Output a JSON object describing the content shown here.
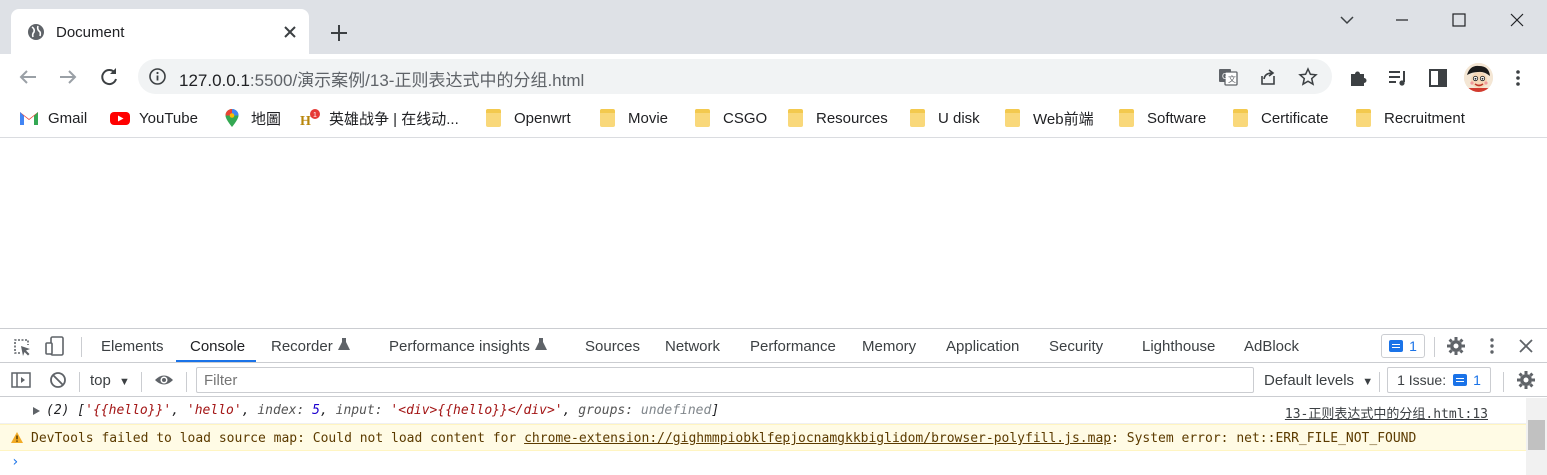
{
  "tab": {
    "title": "Document"
  },
  "window": {
    "controls": [
      "chevron-down",
      "minimize",
      "maximize",
      "close"
    ]
  },
  "omnibox": {
    "host": "127.0.0.1",
    "path": ":5500/演示案例/13-正则表达式中的分组.html"
  },
  "bookmarks": [
    {
      "label": "Gmail",
      "icon": "gmail-icon"
    },
    {
      "label": "YouTube",
      "icon": "youtube-icon"
    },
    {
      "label": "地圖",
      "icon": "maps-icon"
    },
    {
      "label": "英雄战争 | 在线动...",
      "icon": "game-icon"
    },
    {
      "label": "Openwrt",
      "icon": "folder-icon"
    },
    {
      "label": "Movie",
      "icon": "folder-icon"
    },
    {
      "label": "CSGO",
      "icon": "folder-icon"
    },
    {
      "label": "Resources",
      "icon": "folder-icon"
    },
    {
      "label": "U disk",
      "icon": "folder-icon"
    },
    {
      "label": "Web前端",
      "icon": "folder-icon"
    },
    {
      "label": "Software",
      "icon": "folder-icon"
    },
    {
      "label": "Certificate",
      "icon": "folder-icon"
    },
    {
      "label": "Recruitment",
      "icon": "folder-icon"
    }
  ],
  "devtools": {
    "tabs": [
      "Elements",
      "Console",
      "Recorder",
      "Performance insights",
      "Sources",
      "Network",
      "Performance",
      "Memory",
      "Application",
      "Security",
      "Lighthouse",
      "AdBlock"
    ],
    "active_tab": "Console",
    "issue_badge_count": "1",
    "filterbar": {
      "context": "top",
      "filter_placeholder": "Filter",
      "levels": "Default levels",
      "issues_label": "1 Issue:",
      "issues_count": "1"
    },
    "console": {
      "log": {
        "count": "(2)",
        "item1": "'{{hello}}'",
        "item2": "'hello'",
        "index_key": "index:",
        "index_val": "5",
        "input_key": "input:",
        "input_val": "'<div>{{hello}}</div>'",
        "groups_key": "groups:",
        "groups_val": "undefined",
        "source": "13-正则表达式中的分组.html:13"
      },
      "warning": {
        "prefix": "DevTools failed to load source map: Could not load content for ",
        "url": "chrome-extension://gighmmpiobklfepjocnamgkkbiglidom/browser-polyfill.js.map",
        "suffix": ": System error: net::ERR_FILE_NOT_FOUND"
      },
      "prompt": "›"
    }
  }
}
